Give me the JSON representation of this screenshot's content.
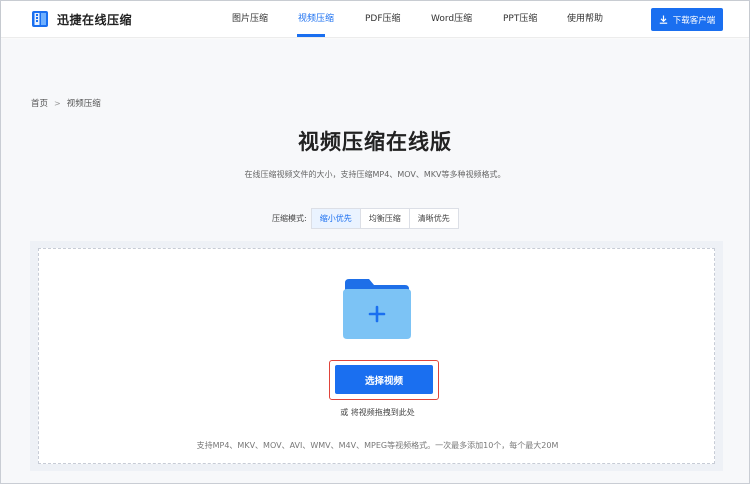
{
  "header": {
    "brand": "迅捷在线压缩",
    "nav": [
      {
        "label": "图片压缩",
        "active": false
      },
      {
        "label": "视频压缩",
        "active": true
      },
      {
        "label": "PDF压缩",
        "active": false
      },
      {
        "label": "Word压缩",
        "active": false
      },
      {
        "label": "PPT压缩",
        "active": false
      },
      {
        "label": "使用帮助",
        "active": false
      }
    ],
    "download_label": "下载客户端",
    "accent_color": "#1a6ff0"
  },
  "breadcrumb": {
    "home": "首页",
    "separator": ">",
    "current": "视频压缩"
  },
  "page": {
    "title": "视频压缩在线版",
    "subtitle": "在线压缩视频文件的大小，支持压缩MP4、MOV、MKV等多种视频格式。"
  },
  "mode": {
    "label": "压缩模式:",
    "options": [
      {
        "label": "缩小优先",
        "active": true
      },
      {
        "label": "均衡压缩",
        "active": false
      },
      {
        "label": "清晰优先",
        "active": false
      }
    ]
  },
  "upload": {
    "button_label": "选择视频",
    "drop_hint": "或 将视频拖拽到此处",
    "support_text": "支持MP4、MKV、MOV、AVI、WMV、M4V、MPEG等视频格式。一次最多添加10个，每个最大20M",
    "icon": "folder-plus-icon",
    "highlight_color": "#e0433a"
  }
}
